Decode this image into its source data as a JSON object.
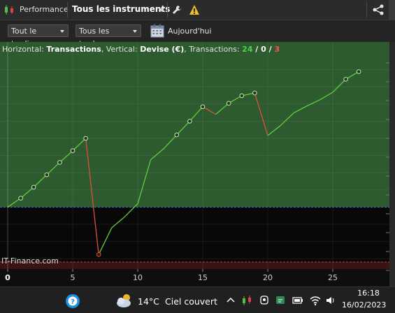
{
  "window": {
    "title": "Performance",
    "instrument_selector": "Tous les instruments",
    "icons": [
      "candlestick-logo-icon",
      "wrench-icon",
      "warning-icon",
      "share-icon"
    ]
  },
  "toolbar": {
    "trading_filter": "Tout le trading",
    "trades_filter": "Tous les trades",
    "date_label": "Aujourd'hui"
  },
  "chart_header": {
    "prefix": "Horizontal: ",
    "horizontal": "Transactions",
    "sep1": ", Vertical: ",
    "vertical": "Devise (€)",
    "sep2": ", Transactions: ",
    "total": "24",
    "winners": "0",
    "losers": "3",
    "slash": " / "
  },
  "watermark": "IT-Finance.com",
  "chart_data": {
    "type": "line",
    "xlabel": "",
    "ylabel": "",
    "x_ticks": [
      "0",
      "5",
      "10",
      "15",
      "20",
      "25"
    ],
    "xlim": [
      0,
      27.5
    ],
    "points": [
      {
        "x": 0,
        "y": 0,
        "marker": false
      },
      {
        "x": 1,
        "y": 13,
        "marker": true
      },
      {
        "x": 2,
        "y": 29,
        "marker": true
      },
      {
        "x": 3,
        "y": 47,
        "marker": true
      },
      {
        "x": 4,
        "y": 65,
        "marker": true
      },
      {
        "x": 5,
        "y": 82,
        "marker": true
      },
      {
        "x": 6,
        "y": 100,
        "marker": true
      },
      {
        "x": 7,
        "y": -69,
        "marker": true
      },
      {
        "x": 8,
        "y": -30,
        "marker": false
      },
      {
        "x": 9,
        "y": -14,
        "marker": false
      },
      {
        "x": 10,
        "y": 5,
        "marker": false
      },
      {
        "x": 11,
        "y": 69,
        "marker": false
      },
      {
        "x": 12,
        "y": 85,
        "marker": false
      },
      {
        "x": 13,
        "y": 105,
        "marker": true
      },
      {
        "x": 14,
        "y": 125,
        "marker": true
      },
      {
        "x": 15,
        "y": 146,
        "marker": true
      },
      {
        "x": 16,
        "y": 135,
        "marker": false
      },
      {
        "x": 17,
        "y": 151,
        "marker": true
      },
      {
        "x": 18,
        "y": 162,
        "marker": true
      },
      {
        "x": 19,
        "y": 166,
        "marker": true
      },
      {
        "x": 20,
        "y": 104,
        "marker": false
      },
      {
        "x": 21,
        "y": 119,
        "marker": false
      },
      {
        "x": 22,
        "y": 137,
        "marker": false
      },
      {
        "x": 23,
        "y": 147,
        "marker": false
      },
      {
        "x": 24,
        "y": 156,
        "marker": false
      },
      {
        "x": 25,
        "y": 167,
        "marker": false
      },
      {
        "x": 26,
        "y": 186,
        "marker": true
      },
      {
        "x": 27,
        "y": 197,
        "marker": true
      }
    ],
    "ylim": [
      -90,
      225
    ],
    "grid": true,
    "colors": {
      "up": "#5fcf3a",
      "down": "#e0503c",
      "profit_zone": "#2d5a2f",
      "loss_zone": "#080808",
      "baseline": "#4a7fd0",
      "limit": "#c04040"
    }
  },
  "taskbar": {
    "temperature": "14°C",
    "condition": "Ciel couvert",
    "time": "16:18",
    "date": "16/02/2023",
    "tray_icons": [
      "help-icon",
      "weather-cloud-icon",
      "chevron-up-icon",
      "chart-app-icon",
      "webcam-icon",
      "chat-icon",
      "battery-icon",
      "wifi-icon",
      "volume-icon"
    ]
  }
}
